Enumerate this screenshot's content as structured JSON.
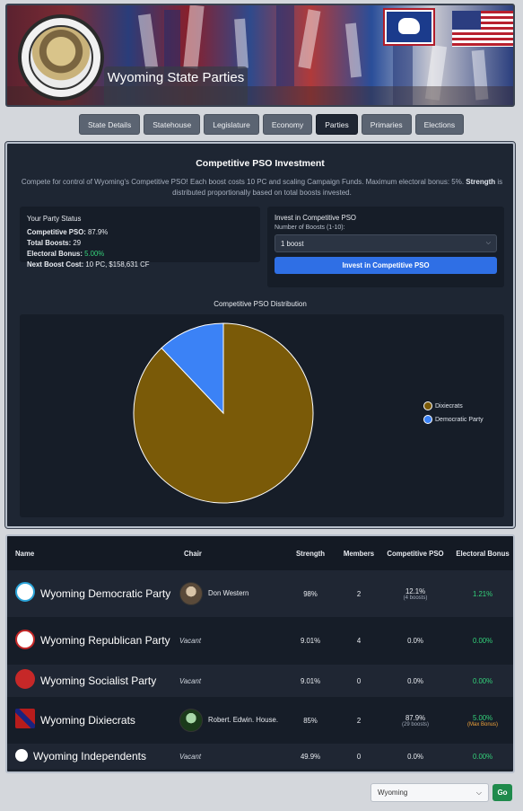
{
  "banner": {
    "title": "Wyoming State Parties"
  },
  "tabs": [
    "State Details",
    "Statehouse",
    "Legislature",
    "Economy",
    "Parties",
    "Primaries",
    "Elections"
  ],
  "active_tab": "Parties",
  "pso": {
    "heading": "Competitive PSO Investment",
    "desc_main": "Compete for control of Wyoming's Competitive PSO! Each boost costs 10 PC and scaling Campaign Funds. Maximum electoral bonus: 5%. ",
    "desc_bold": "Strength",
    "desc_tail": " is distributed proportionally based on total boosts invested.",
    "status": {
      "heading": "Your Party Status",
      "pso_label": "Competitive PSO:",
      "pso_value": "87.9%",
      "boosts_label": "Total Boosts:",
      "boosts_value": "29",
      "bonus_label": "Electoral Bonus:",
      "bonus_value": "5.00%",
      "cost_label": "Next Boost Cost:",
      "cost_value": "10 PC, $158,631 CF"
    },
    "invest": {
      "heading": "Invest in Competitive PSO",
      "boosts_label": "Number of Boosts (1-10):",
      "boosts_selected": "1 boost",
      "button": "Invest in Competitive PSO"
    },
    "chart_title": "Competitive PSO Distribution"
  },
  "chart_data": {
    "type": "pie",
    "title": "Competitive PSO Distribution",
    "labels": [
      "Dixiecrats",
      "Democratic Party"
    ],
    "values": [
      87.9,
      12.1
    ],
    "colors": [
      "#7a5a08",
      "#3b82f6"
    ],
    "legend_position": "right"
  },
  "table": {
    "headers": {
      "name": "Name",
      "chair": "Chair",
      "strength": "Strength",
      "members": "Members",
      "pso": "Competitive PSO",
      "bonus": "Electoral Bonus"
    },
    "rows": [
      {
        "name": "Wyoming Democratic Party",
        "chair": "Don Western",
        "strength": "98%",
        "members": "2",
        "pso": "12.1%",
        "pso_sub": "(4 boosts)",
        "bonus": "1.21%",
        "bonus_sub": ""
      },
      {
        "name": "Wyoming Republican Party",
        "chair": "Vacant",
        "strength": "9.01%",
        "members": "4",
        "pso": "0.0%",
        "pso_sub": "",
        "bonus": "0.00%",
        "bonus_sub": ""
      },
      {
        "name": "Wyoming Socialist Party",
        "chair": "Vacant",
        "strength": "9.01%",
        "members": "0",
        "pso": "0.0%",
        "pso_sub": "",
        "bonus": "0.00%",
        "bonus_sub": ""
      },
      {
        "name": "Wyoming Dixiecrats",
        "chair": "Robert. Edwin. House.",
        "strength": "85%",
        "members": "2",
        "pso": "87.9%",
        "pso_sub": "(29 boosts)",
        "bonus": "5.00%",
        "bonus_sub": "(Max Bonus)"
      },
      {
        "name": "Wyoming Independents",
        "chair": "Vacant",
        "strength": "49.9%",
        "members": "0",
        "pso": "0.0%",
        "pso_sub": "",
        "bonus": "0.00%",
        "bonus_sub": ""
      }
    ]
  },
  "footer": {
    "state_selected": "Wyoming",
    "go": "Go"
  }
}
